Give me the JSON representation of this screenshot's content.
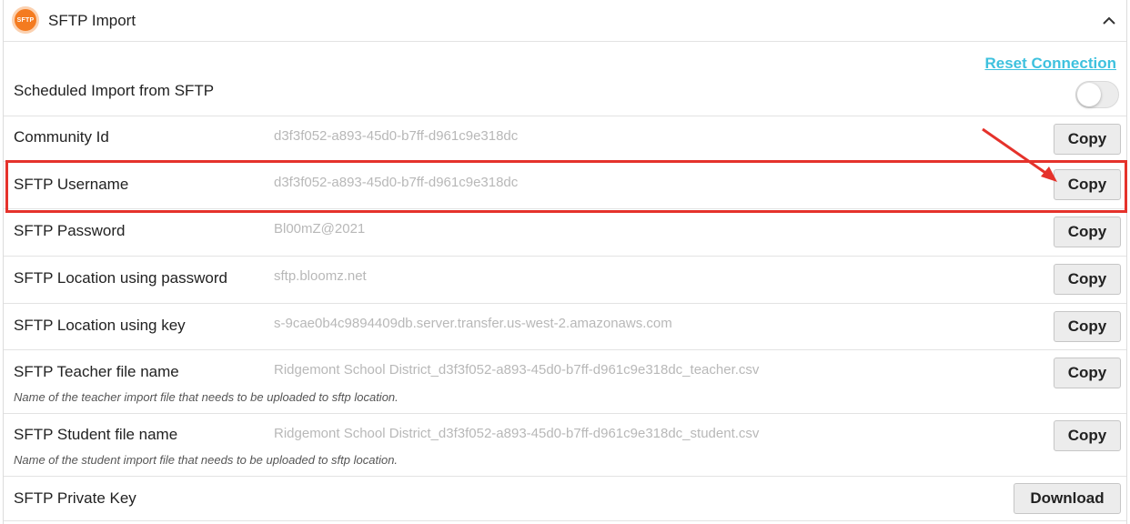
{
  "header": {
    "logo_text": "SFTP",
    "title": "SFTP Import",
    "collapse_icon": "chevron-up-icon"
  },
  "reset_link": "Reset Connection",
  "scheduled_import": {
    "label": "Scheduled Import from SFTP",
    "enabled": false
  },
  "rows": [
    {
      "label": "Community Id",
      "value": "d3f3f052-a893-45d0-b7ff-d961c9e318dc",
      "button": "Copy"
    },
    {
      "label": "SFTP Username",
      "value": "d3f3f052-a893-45d0-b7ff-d961c9e318dc",
      "button": "Copy"
    },
    {
      "label": "SFTP Password",
      "value": "Bl00mZ@2021",
      "button": "Copy"
    },
    {
      "label": "SFTP Location using password",
      "value": "sftp.bloomz.net",
      "button": "Copy"
    },
    {
      "label": "SFTP Location using key",
      "value": "s-9cae0b4c9894409db.server.transfer.us-west-2.amazonaws.com",
      "button": "Copy"
    },
    {
      "label": "SFTP Teacher file name",
      "value": "Ridgemont School District_d3f3f052-a893-45d0-b7ff-d961c9e318dc_teacher.csv",
      "hint": "Name of the teacher import file that needs to be uploaded to sftp location.",
      "button": "Copy"
    },
    {
      "label": "SFTP Student file name",
      "value": "Ridgemont School District_d3f3f052-a893-45d0-b7ff-d961c9e318dc_student.csv",
      "hint": "Name of the student import file that needs to be uploaded to sftp location.",
      "button": "Copy"
    },
    {
      "label": "SFTP Private Key",
      "value": "",
      "button": "Download"
    }
  ],
  "colors": {
    "accent_link": "#3ec1de",
    "brand_orange": "#f47b20",
    "highlight_red": "#e5322b"
  }
}
